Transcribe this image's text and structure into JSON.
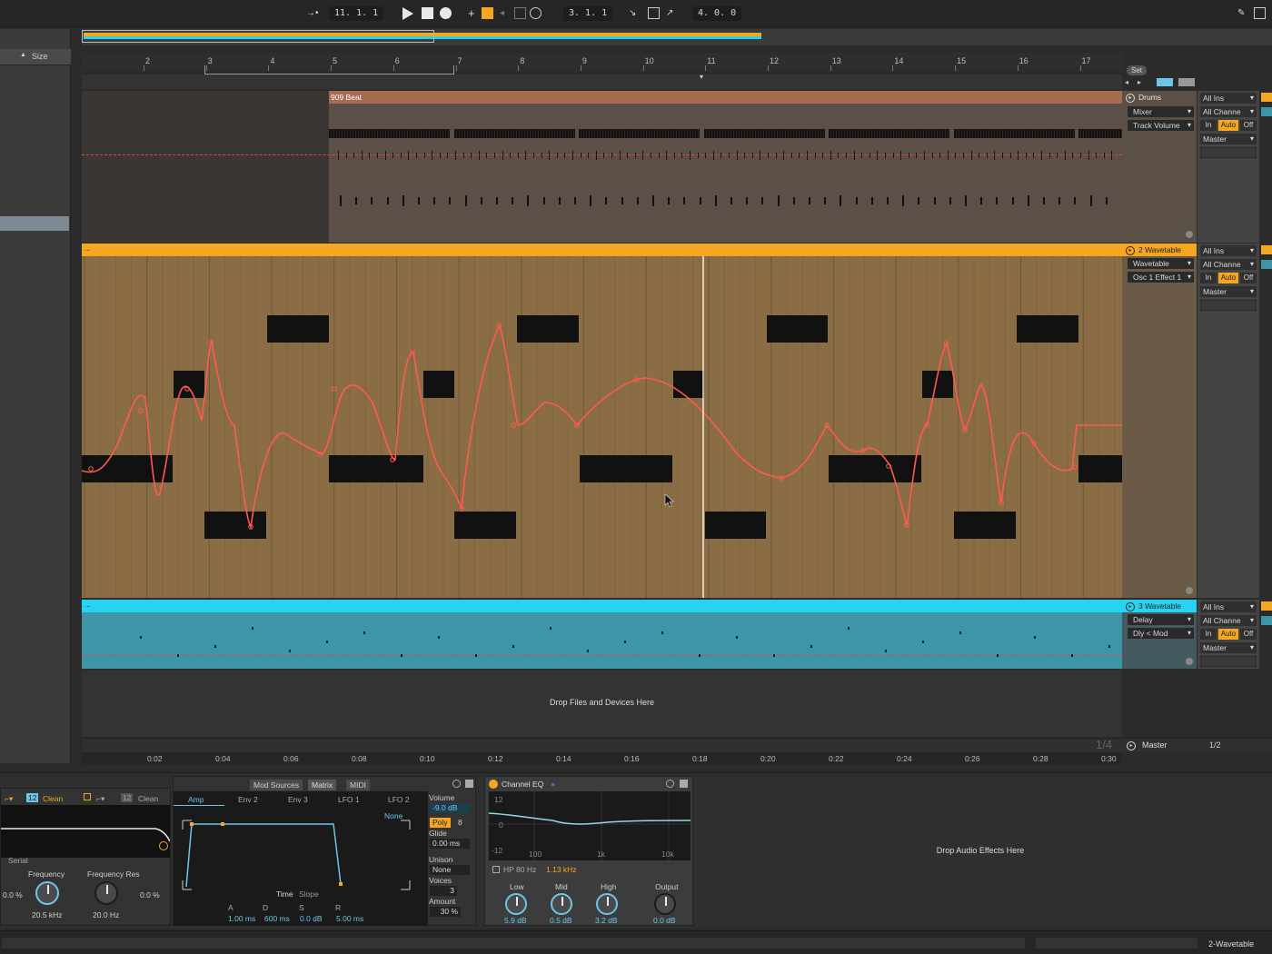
{
  "transport": {
    "arrangement_position": "11.  1.  1",
    "loop_start": "3.  1.  1",
    "loop_length": "4.  0.  0"
  },
  "browser": {
    "column_header": "Size"
  },
  "ruler": {
    "bars": [
      "2",
      "3",
      "4",
      "5",
      "6",
      "7",
      "8",
      "9",
      "10",
      "11",
      "12",
      "13",
      "14",
      "15",
      "16",
      "17"
    ],
    "times": [
      "0:02",
      "0:04",
      "0:06",
      "0:08",
      "0:10",
      "0:12",
      "0:14",
      "0:16",
      "0:18",
      "0:20",
      "0:22",
      "0:24",
      "0:26",
      "0:28",
      "0:30"
    ]
  },
  "scene_set": {
    "label": "Set"
  },
  "tracks": {
    "drums": {
      "clip_name": "909 Beat",
      "title": "Drums",
      "device": "Mixer",
      "parameter": "Track Volume",
      "input_type": "All Ins",
      "input_channel": "All Channe",
      "monitor": [
        "In",
        "Auto",
        "Off"
      ],
      "output": "Master",
      "color": "#c97e5a"
    },
    "wavetable2": {
      "title": "2 Wavetable",
      "device": "Wavetable",
      "parameter": "Osc 1 Effect 1",
      "input_type": "All Ins",
      "input_channel": "All Channe",
      "monitor": [
        "In",
        "Auto",
        "Off"
      ],
      "output": "Master",
      "color": "#f5a623",
      "clip_color": "#8b6d45"
    },
    "wavetable3": {
      "title": "3 Wavetable",
      "device": "Delay",
      "parameter": "Dly < Mod",
      "input_type": "All Ins",
      "input_channel": "All Channe",
      "monitor": [
        "In",
        "Auto",
        "Off"
      ],
      "output": "Master",
      "color": "#27d3f0",
      "clip_color": "#3d95a6"
    },
    "drop_text": "Drop Files and Devices Here",
    "master": {
      "title": "Master",
      "fraction": "1/2",
      "zoom_hint": "1/4"
    }
  },
  "wavetable_device": {
    "filter_type": "Clean",
    "filter_type_2": "Clean",
    "filter_num": "12",
    "filter_num_2": "12",
    "routing": "Serial",
    "frequency_label": "Frequency",
    "frequency_value": "20.5 kHz",
    "freq_res_label": "Frequency Res",
    "freq_res_value": "20.0 Hz",
    "pct_left": "0.0 %",
    "pct_right": "0.0 %",
    "tabs_top": [
      "Mod Sources",
      "Matrix",
      "MIDI"
    ],
    "mod_tabs": [
      "Amp",
      "Env 2",
      "Env 3",
      "LFO 1",
      "LFO 2"
    ],
    "env_target": "None",
    "env_time": "Time",
    "env_slope": "Slope",
    "adsr_labels": [
      "A",
      "D",
      "S",
      "R"
    ],
    "adsr_values": [
      "1.00 ms",
      "600 ms",
      "0.0 dB",
      "5.00 ms"
    ],
    "volume_label": "Volume",
    "volume_value": "-9.0 dB",
    "poly": "Poly",
    "poly_voices": "8",
    "glide_label": "Glide",
    "glide_value": "0.00 ms",
    "unison_label": "Unison",
    "unison_value": "None",
    "voices_label": "Voices",
    "voices_value": "3",
    "amount_label": "Amount",
    "amount_value": "30 %"
  },
  "channel_eq": {
    "title": "Channel EQ",
    "db_ticks": [
      "12",
      "0",
      "-12"
    ],
    "freq_ticks": [
      "100",
      "1k",
      "10k"
    ],
    "hp_label": "HP 80 Hz",
    "hp_freq": "1.13 kHz",
    "knobs": [
      {
        "label": "Low",
        "value": "5.9 dB"
      },
      {
        "label": "Mid",
        "value": "0.5 dB"
      },
      {
        "label": "High",
        "value": "3.2 dB"
      },
      {
        "label": "Output",
        "value": "0.0 dB"
      }
    ]
  },
  "drop_effects": "Drop Audio Effects Here",
  "status": {
    "selected_track": "2-Wavetable"
  },
  "colors": {
    "accent_orange": "#f5a623",
    "accent_cyan": "#27d3f0",
    "automation": "#ff5a4d"
  }
}
